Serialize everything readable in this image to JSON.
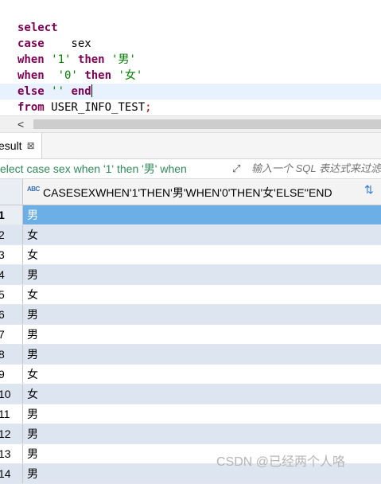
{
  "editor": {
    "lines": [
      {
        "parts": [
          {
            "t": "select",
            "c": "kw"
          }
        ]
      },
      {
        "parts": [
          {
            "t": "case",
            "c": "kw"
          },
          {
            "t": "    sex",
            "c": "plain"
          }
        ]
      },
      {
        "parts": [
          {
            "t": "when",
            "c": "kw"
          },
          {
            "t": " ",
            "c": "plain"
          },
          {
            "t": "'1'",
            "c": "str"
          },
          {
            "t": " ",
            "c": "plain"
          },
          {
            "t": "then",
            "c": "kw"
          },
          {
            "t": " ",
            "c": "plain"
          },
          {
            "t": "'男'",
            "c": "str"
          }
        ]
      },
      {
        "parts": [
          {
            "t": "when",
            "c": "kw"
          },
          {
            "t": "  ",
            "c": "plain"
          },
          {
            "t": "'0'",
            "c": "str"
          },
          {
            "t": " ",
            "c": "plain"
          },
          {
            "t": "then",
            "c": "kw"
          },
          {
            "t": " ",
            "c": "plain"
          },
          {
            "t": "'女'",
            "c": "str"
          }
        ]
      },
      {
        "parts": [
          {
            "t": "else",
            "c": "kw"
          },
          {
            "t": " ",
            "c": "plain"
          },
          {
            "t": "''",
            "c": "str"
          },
          {
            "t": " ",
            "c": "plain"
          },
          {
            "t": "end",
            "c": "kw"
          }
        ],
        "current": true
      },
      {
        "parts": [
          {
            "t": "from",
            "c": "kw"
          },
          {
            "t": " USER_INFO_TEST",
            "c": "plain"
          },
          {
            "t": ";",
            "c": "op"
          }
        ]
      }
    ]
  },
  "scrollbar": {
    "left_arrow": "<"
  },
  "results_tab": {
    "label": "esult",
    "close_glyph": "⊠"
  },
  "filter": {
    "query_text": "elect case         sex when '1' then '男' when",
    "placeholder": "输入一个 SQL 表达式来过滤"
  },
  "grid": {
    "column_type_icon": "ABC",
    "column_title": "CASESEXWHEN'1'THEN'男'WHEN'0'THEN'女'ELSE''END",
    "rows": [
      {
        "num": "1",
        "value": "男"
      },
      {
        "num": "2",
        "value": "女"
      },
      {
        "num": "3",
        "value": "女"
      },
      {
        "num": "4",
        "value": "男"
      },
      {
        "num": "5",
        "value": "女"
      },
      {
        "num": "6",
        "value": "男"
      },
      {
        "num": "7",
        "value": "男"
      },
      {
        "num": "8",
        "value": "男"
      },
      {
        "num": "9",
        "value": "女"
      },
      {
        "num": "10",
        "value": "女"
      },
      {
        "num": "11",
        "value": "男"
      },
      {
        "num": "12",
        "value": "男"
      },
      {
        "num": "13",
        "value": "男"
      },
      {
        "num": "14",
        "value": "男"
      }
    ],
    "selected_row_index": 0
  },
  "watermark": "CSDN @已经两个人咯"
}
